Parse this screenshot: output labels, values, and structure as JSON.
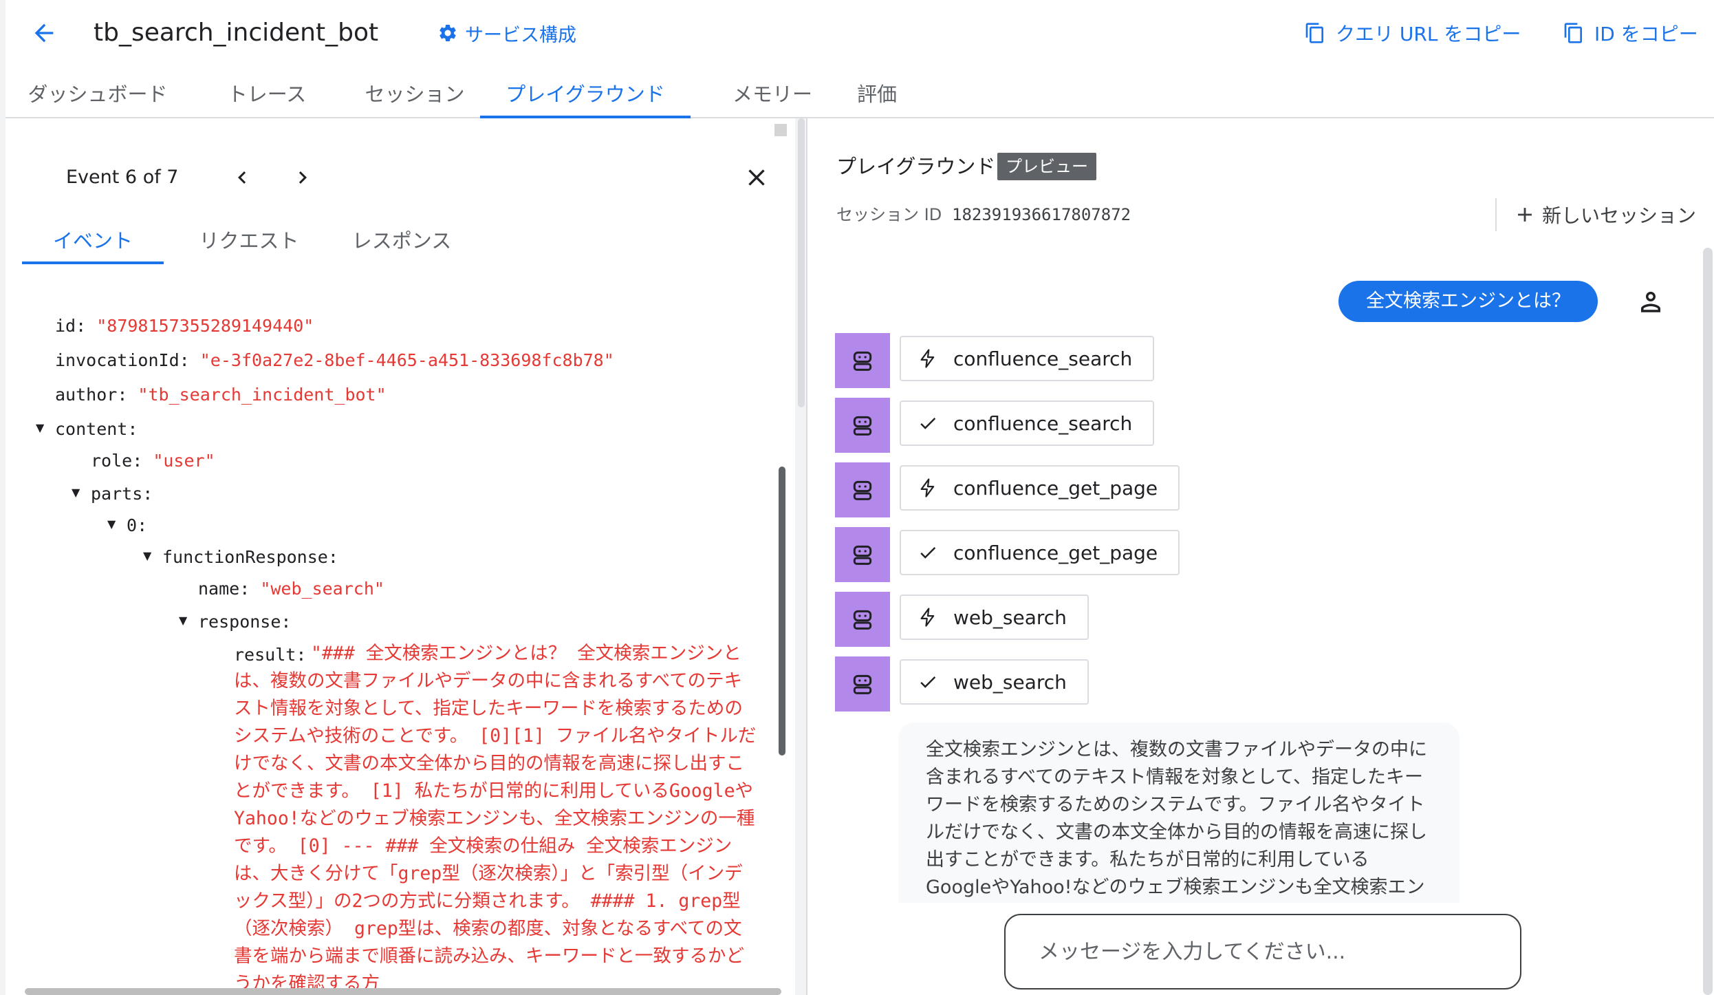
{
  "header": {
    "title": "tb_search_incident_bot",
    "service_config": "サービス構成",
    "copy_url": "クエリ URL をコピー",
    "copy_id": "ID をコピー"
  },
  "main_tabs": [
    {
      "label": "ダッシュボード"
    },
    {
      "label": "トレース"
    },
    {
      "label": "セッション"
    },
    {
      "label": "プレイグラウンド",
      "active": true
    },
    {
      "label": "メモリー"
    },
    {
      "label": "評価"
    }
  ],
  "event_panel": {
    "counter": "Event 6 of 7",
    "tabs": [
      {
        "label": "イベント",
        "active": true
      },
      {
        "label": "リクエスト"
      },
      {
        "label": "レスポンス"
      }
    ],
    "fields": {
      "id_key": "id",
      "id_val": "\"8798157355289149440\"",
      "invocation_key": "invocationId",
      "invocation_val": "\"e-3f0a27e2-8bef-4465-a451-833698fc8b78\"",
      "author_key": "author",
      "author_val": "\"tb_search_incident_bot\"",
      "content_key": "content",
      "role_key": "role",
      "role_val": "\"user\"",
      "parts_key": "parts",
      "index_key": "0",
      "fr_key": "functionResponse",
      "name_key": "name",
      "name_val": "\"web_search\"",
      "response_key": "response",
      "result_key": "result",
      "result_val": "\"### 全文検索エンジンとは？ 全文検索エンジンとは、複数の文書ファイルやデータの中に含まれるすべてのテキスト情報を対象として、指定したキーワードを検索するためのシステムや技術のことです。 [0][1] ファイル名やタイトルだけでなく、文書の本文全体から目的の情報を高速に探し出すことができます。 [1] 私たちが日常的に利用しているGoogleやYahoo!などのウェブ検索エンジンも、全文検索エンジンの一種です。 [0] --- ### 全文検索の仕組み 全文検索エンジンは、大きく分けて「grep型（逐次検索）」と「索引型（インデックス型）」の2つの方式に分類されます。 #### 1. grep型（逐次検索） grep型は、検索の都度、対象となるすべての文書を端から端まで順番に読み込み、キーワードと一致するかどうかを確認する方"
    }
  },
  "playground": {
    "title": "プレイグラウンド",
    "badge": "プレビュー",
    "session_label": "セッション ID",
    "session_id": "182391936617807872",
    "new_session": "新しいセッション",
    "user_message": "全文検索エンジンとは？",
    "tool_calls": [
      {
        "name": "confluence_search",
        "status": "call"
      },
      {
        "name": "confluence_search",
        "status": "done"
      },
      {
        "name": "confluence_get_page",
        "status": "call"
      },
      {
        "name": "confluence_get_page",
        "status": "done"
      },
      {
        "name": "web_search",
        "status": "call"
      },
      {
        "name": "web_search",
        "status": "done"
      }
    ],
    "answer": "全文検索エンジンとは、複数の文書ファイルやデータの中に含まれるすべてのテキスト情報を対象として、指定したキーワードを検索するためのシステムです。ファイル名やタイトルだけでなく、文書の本文全体から目的の情報を高速に探し出すことができます。私たちが日常的に利用しているGoogleやYahoo!などのウェブ検索エンジンも全文検索エンジンの一種です。",
    "input_placeholder": "メッセージを入力してください..."
  },
  "colors": {
    "accent": "#1a73e8",
    "value_red": "#e53935",
    "bot_purple": "#b388eb"
  },
  "icons": {
    "back": "arrow-left-icon",
    "service": "gear-icon",
    "copy": "copy-icon",
    "prev": "chevron-left-icon",
    "next": "chevron-right-icon",
    "close": "close-icon",
    "new": "plus-icon",
    "user": "person-icon",
    "bot": "robot-icon",
    "call": "bolt-icon",
    "done": "check-icon"
  }
}
